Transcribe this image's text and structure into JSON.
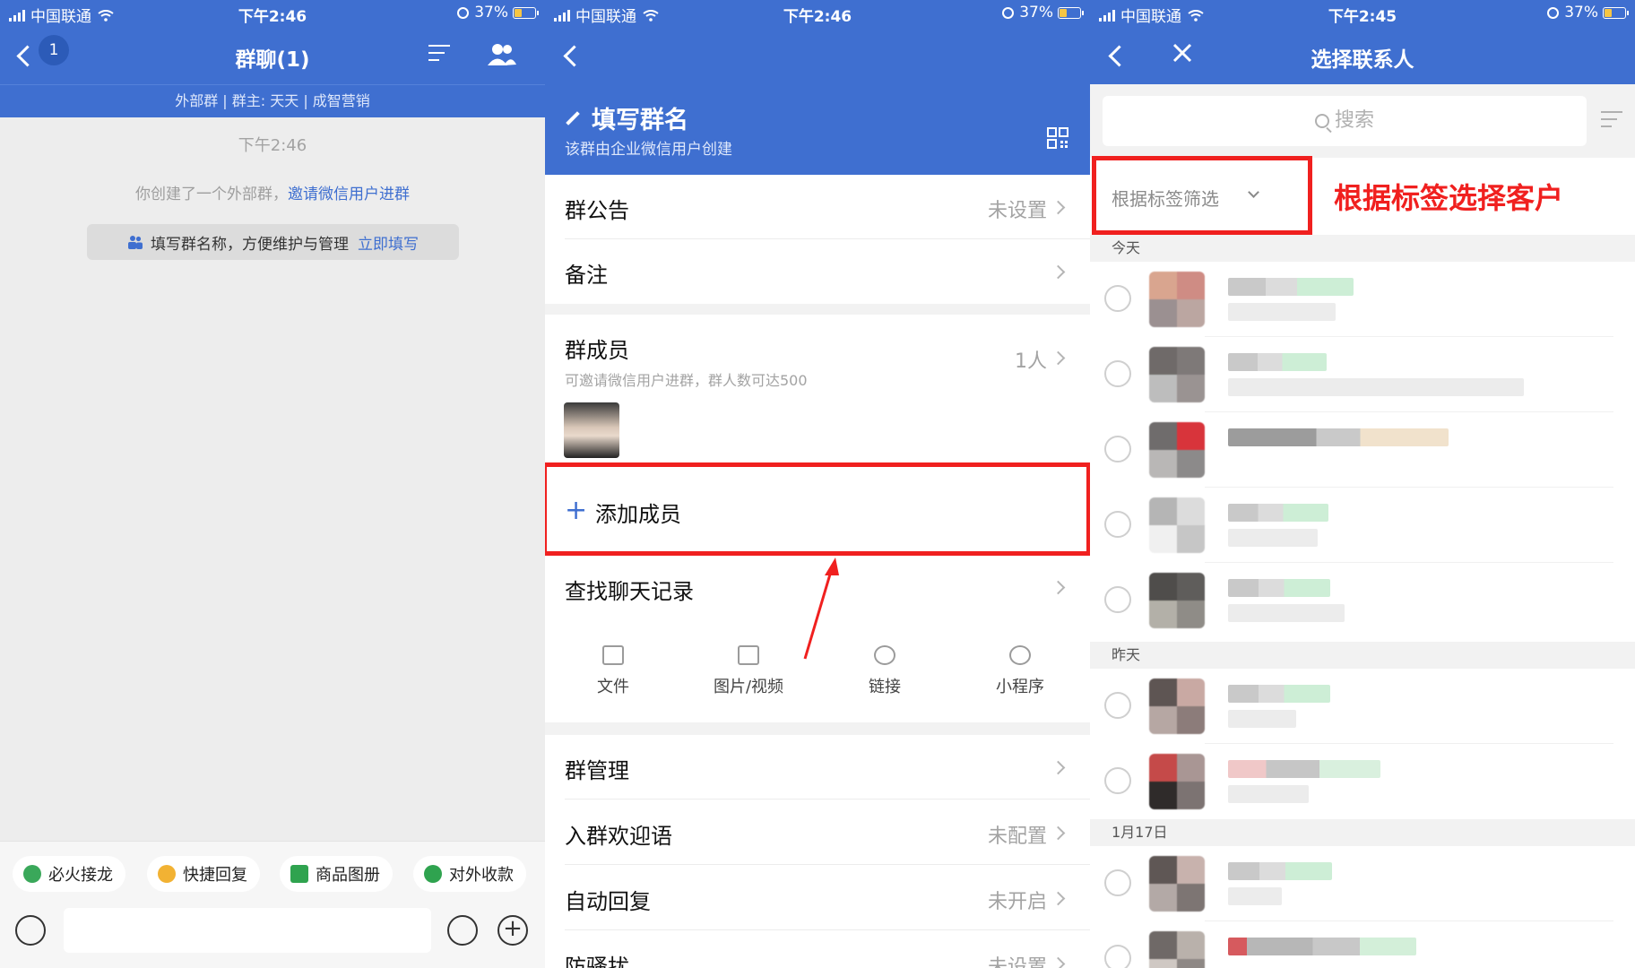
{
  "status_bar": {
    "carrier": "中国联通",
    "time_1": "下午2:46",
    "time_2": "下午2:46",
    "time_3": "下午2:45",
    "battery": "37%"
  },
  "panel1": {
    "back_badge": "1",
    "title": "群聊(1)",
    "subheader": "外部群 | 群主: 天天  |  成智营销",
    "time_label": "下午2:46",
    "system_msg": "你创建了一个外部群，",
    "system_link": "邀请微信用户进群",
    "tip_text": "填写群名称，方便维护与管理",
    "tip_link": "立即填写",
    "chips": [
      "必火接龙",
      "快捷回复",
      "商品图册",
      "对外收款"
    ],
    "accent": "#3f6fd0"
  },
  "panel2": {
    "group_name": "填写群名",
    "group_sub": "该群由企业微信用户创建",
    "rows": [
      {
        "label": "群公告",
        "value": "未设置"
      },
      {
        "label": "备注",
        "value": ""
      }
    ],
    "members_label": "群成员",
    "members_sub": "可邀请微信用户进群，群人数可达500",
    "members_count": "1人",
    "add_member": "添加成员",
    "search_history": "查找聊天记录",
    "media": [
      "文件",
      "图片/视频",
      "链接",
      "小程序"
    ],
    "rows2": [
      {
        "label": "群管理",
        "value": ""
      },
      {
        "label": "入群欢迎语",
        "value": "未配置"
      },
      {
        "label": "自动回复",
        "value": "未开启"
      },
      {
        "label": "防骚扰",
        "value": "未设置"
      }
    ],
    "highlight_color": "#f0201f"
  },
  "panel3": {
    "title": "选择联系人",
    "search_placeholder": "搜索",
    "filter_label": "根据标签筛选",
    "annotation": "根据标签选择客户",
    "sections": [
      "今天",
      "昨天",
      "1月17日"
    ]
  }
}
